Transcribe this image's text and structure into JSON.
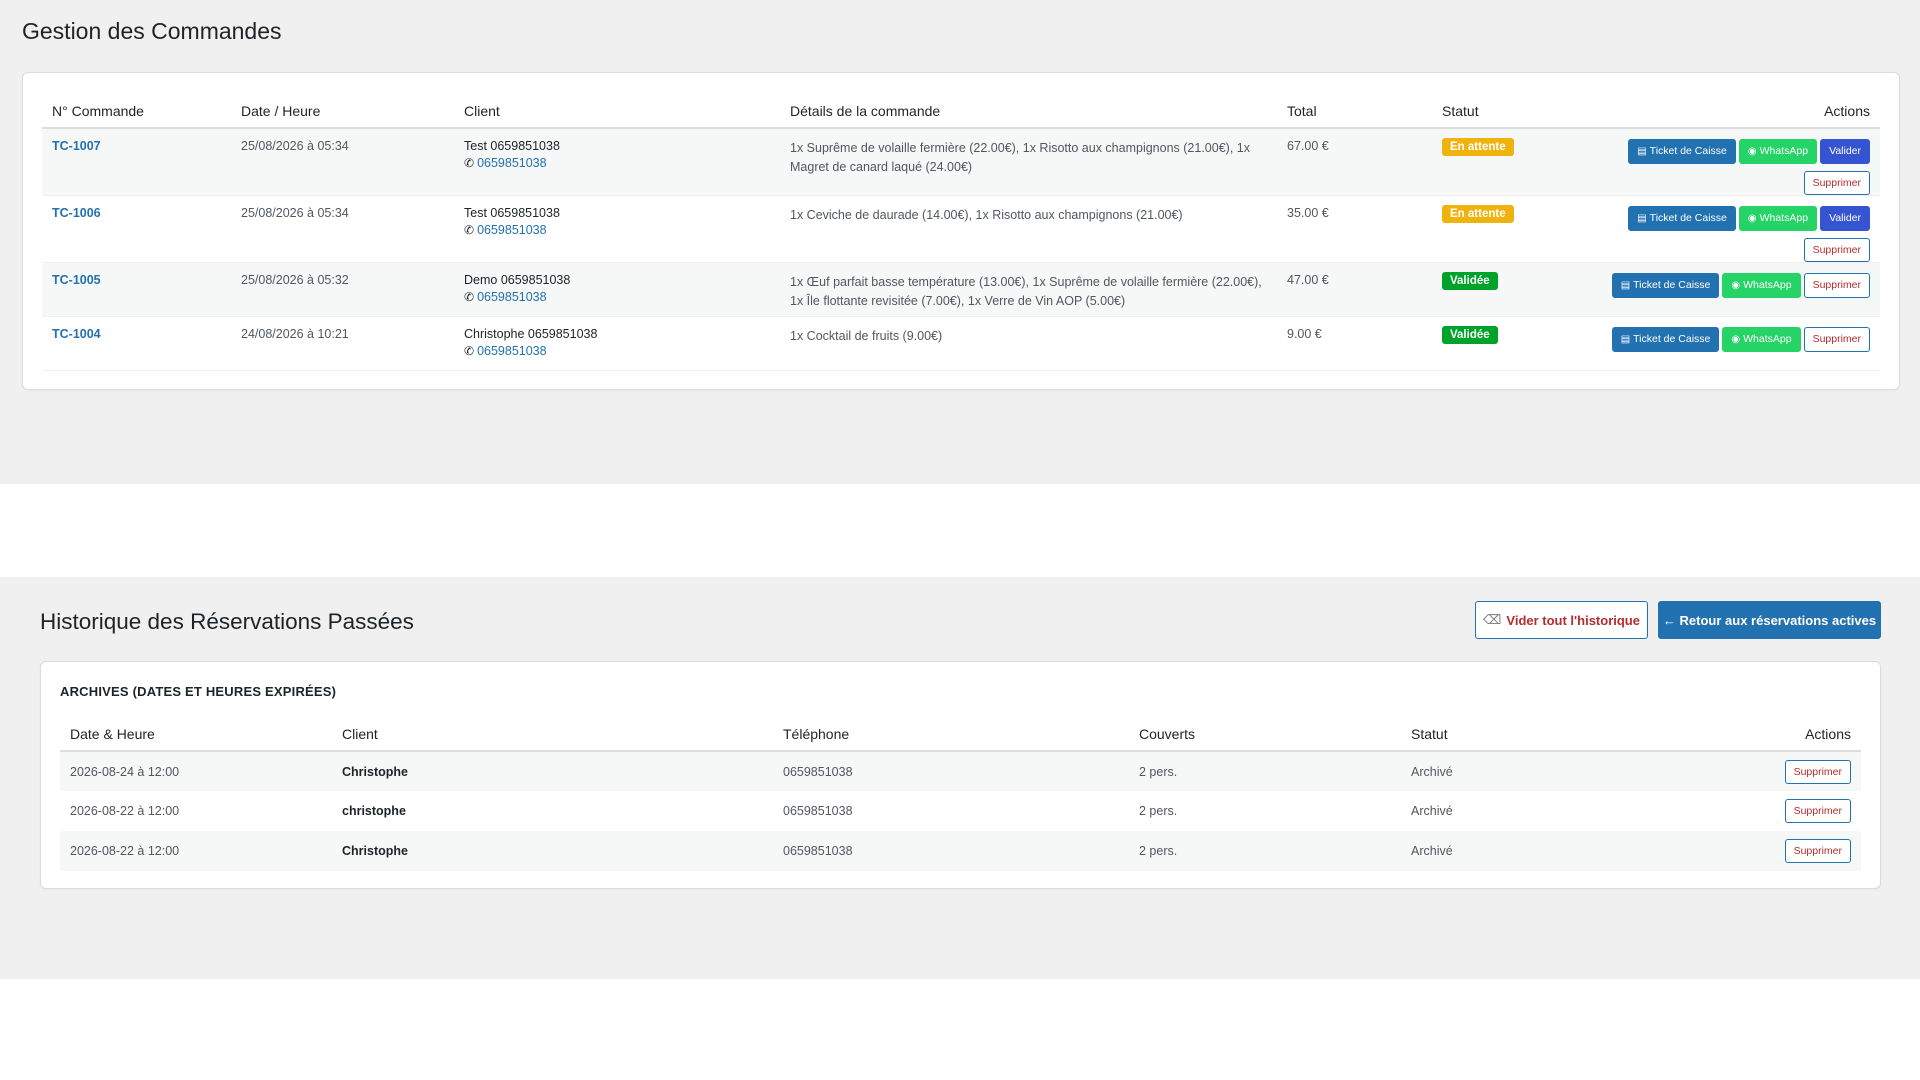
{
  "orders": {
    "title": "Gestion des Commandes",
    "headers": [
      "N° Commande",
      "Date / Heure",
      "Client",
      "Détails de la commande",
      "Total",
      "Statut",
      "Actions"
    ],
    "rows": [
      {
        "id": "TC-1007",
        "datetime": "25/08/2026 à 05:34",
        "client": "Test 0659851038",
        "phone": "0659851038",
        "details": "1x Suprême de volaille fermière (22.00€), 1x Risotto aux champignons (21.00€), 1x Magret de canard laqué (24.00€)",
        "total": "67.00 €",
        "status": "En attente"
      },
      {
        "id": "TC-1006",
        "datetime": "25/08/2026 à 05:34",
        "client": "Test 0659851038",
        "phone": "0659851038",
        "details": "1x Ceviche de daurade (14.00€), 1x Risotto aux champignons (21.00€)",
        "total": "35.00 €",
        "status": "En attente"
      },
      {
        "id": "TC-1005",
        "datetime": "25/08/2026 à 05:32",
        "client": "Demo 0659851038",
        "phone": "0659851038",
        "details": "1x Œuf parfait basse température (13.00€), 1x Suprême de volaille fermière (22.00€), 1x Île flottante revisitée (7.00€), 1x Verre de Vin AOP (5.00€)",
        "total": "47.00 €",
        "status": "Validée"
      },
      {
        "id": "TC-1004",
        "datetime": "24/08/2026 à 10:21",
        "client": "Christophe 0659851038",
        "phone": "0659851038",
        "details": "1x Cocktail de fruits (9.00€)",
        "total": "9.00 €",
        "status": "Validée"
      }
    ],
    "buttons": {
      "ticket": "Ticket de Caisse",
      "whatsapp": "WhatsApp",
      "validate": "Valider",
      "delete": "Supprimer"
    },
    "icons": {
      "phone": "phone-icon",
      "ticket": "receipt-icon",
      "whatsapp": "chat-icon"
    }
  },
  "history": {
    "title": "Historique des Réservations Passées",
    "clear_button": "Vider tout l'historique",
    "back_button": "← Retour aux réservations actives",
    "archive_label": "ARCHIVES (DATES ET HEURES EXPIRÉES)",
    "headers": [
      "Date & Heure",
      "Client",
      "Téléphone",
      "Couverts",
      "Statut",
      "Actions"
    ],
    "rows": [
      {
        "datetime": "2026-08-24 à 12:00",
        "client": "Christophe",
        "phone": "0659851038",
        "covers": "2 pers.",
        "status": "Archivé"
      },
      {
        "datetime": "2026-08-22 à 12:00",
        "client": "christophe",
        "phone": "0659851038",
        "covers": "2 pers.",
        "status": "Archivé"
      },
      {
        "datetime": "2026-08-22 à 12:00",
        "client": "Christophe",
        "phone": "0659851038",
        "covers": "2 pers.",
        "status": "Archivé"
      }
    ],
    "delete_button": "Supprimer"
  },
  "colors": {
    "primary": "#2271b1",
    "whatsapp": "#25d366",
    "validate": "#3454d1",
    "pending": "#f0b30e",
    "validated": "#00a32a",
    "danger": "#b32d2e",
    "background": "#f0f0f1"
  }
}
